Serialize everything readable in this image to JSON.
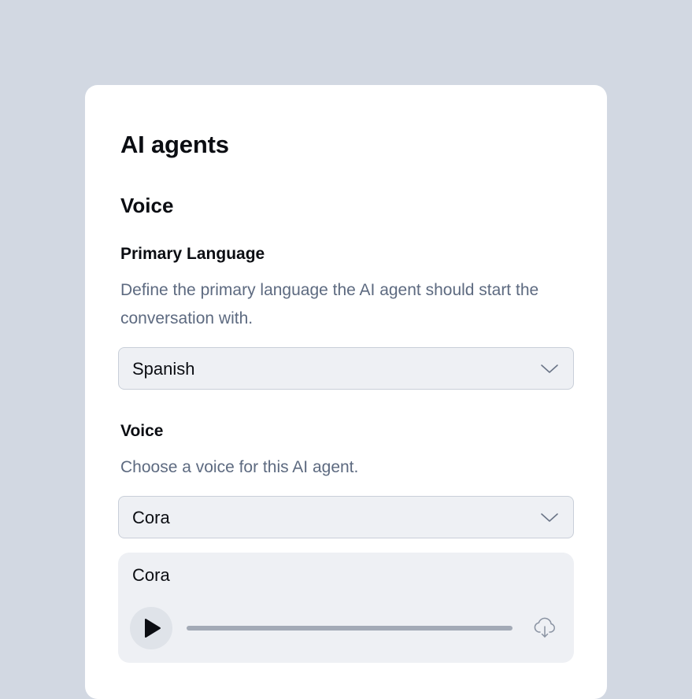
{
  "page": {
    "title": "AI agents"
  },
  "voice_section": {
    "title": "Voice",
    "primary_language": {
      "label": "Primary Language",
      "description": "Define the primary language the AI agent should start the conversation with.",
      "selected": "Spanish",
      "icon": "chevron-down-icon"
    },
    "voice": {
      "label": "Voice",
      "description": "Choose a voice for this AI agent.",
      "selected": "Cora",
      "icon": "chevron-down-icon"
    },
    "preview": {
      "name": "Cora",
      "play_icon": "play-icon",
      "download_icon": "cloud-download-icon",
      "progress": 0
    }
  },
  "colors": {
    "background": "#d2d8e2",
    "card": "#ffffff",
    "select_bg": "#eef0f4",
    "muted_text": "#5d6a80"
  }
}
